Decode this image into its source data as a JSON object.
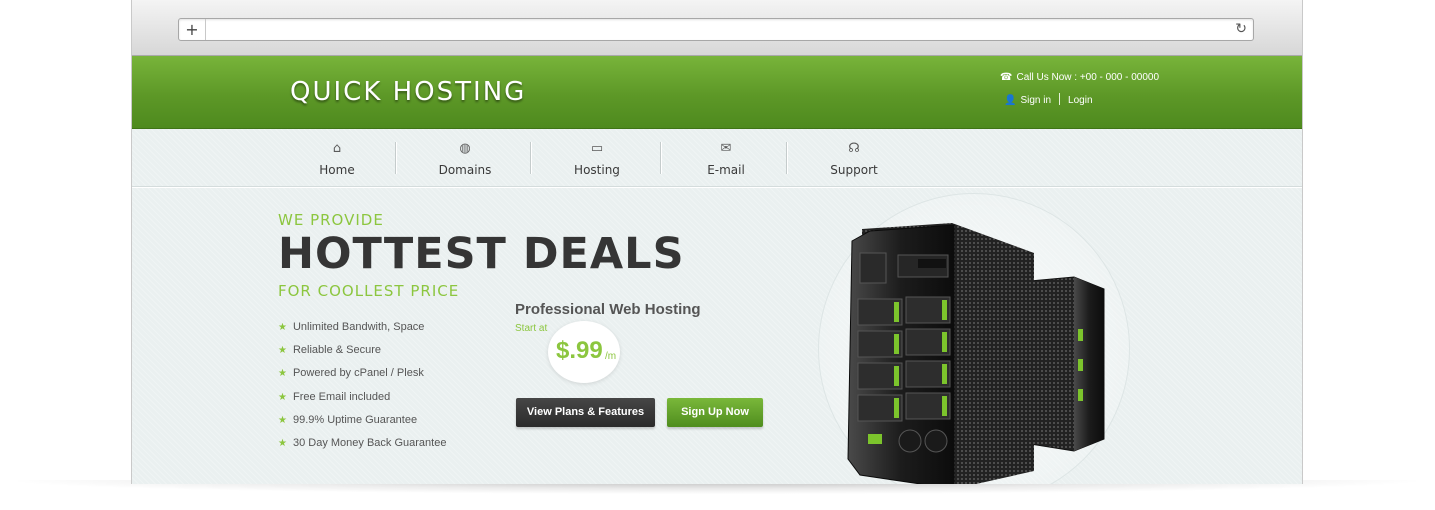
{
  "browser": {
    "new_tab_icon": "plus-icon",
    "reload_icon": "reload-icon"
  },
  "header": {
    "logo": "QUICK HOSTING",
    "call_now": "Call Us Now : +00 - 000 - 00000",
    "sign_in": "Sign in",
    "login": "Login"
  },
  "nav": {
    "items": [
      {
        "label": "Home",
        "icon": "home-icon"
      },
      {
        "label": "Domains",
        "icon": "globe-icon"
      },
      {
        "label": "Hosting",
        "icon": "monitor-icon"
      },
      {
        "label": "E-mail",
        "icon": "envelope-icon"
      },
      {
        "label": "Support",
        "icon": "headset-icon"
      }
    ]
  },
  "hero": {
    "line1": "WE PROVIDE",
    "line2": "HOTTEST DEALS",
    "line3": "FOR COOLLEST PRICE",
    "features": [
      "Unlimited Bandwith, Space",
      "Reliable & Secure",
      "Powered by cPanel / Plesk",
      "Free Email included",
      "99.9% Uptime Guarantee",
      "30 Day Money Back Guarantee"
    ],
    "product_title": "Professional Web Hosting",
    "start_at": "Start at",
    "price": "$.99",
    "price_unit": "/m",
    "btn_plans": "View Plans & Features",
    "btn_signup": "Sign Up Now"
  },
  "colors": {
    "brand_green": "#6aa62e",
    "accent_green": "#8cc63f",
    "dark": "#353535"
  }
}
